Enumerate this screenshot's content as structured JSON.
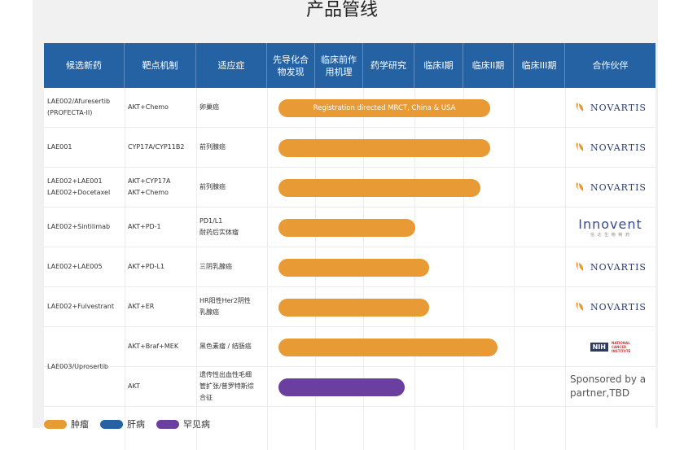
{
  "title": "产品管线",
  "header": [
    "候选新药",
    "靶点机制",
    "适应症",
    "先导化合物发现",
    "临床前作用机理",
    "药学研究",
    "临床I期",
    "临床II期",
    "临床III期",
    "合作伙伴"
  ],
  "rows": [
    {
      "drug": "LAE002/Afuresertib (PROFECTA-II)",
      "target": "AKT+Chemo",
      "indication": "卵巢癌",
      "bar_label": "Registration directed MRCT, China & USA",
      "progress": 0.62,
      "color": "orange",
      "partner": "novartis"
    },
    {
      "drug": "LAE001",
      "target": "CYP17A/CYP11B2",
      "indication": "前列腺癌",
      "bar_label": "",
      "progress": 0.62,
      "color": "orange",
      "partner": "novartis"
    },
    {
      "drug": "LAE002+LAE001\nLAE002+Docetaxel",
      "target": "AKT+CYP17A\nAKT+Chemo",
      "indication": "前列腺癌",
      "bar_label": "",
      "progress": 0.59,
      "color": "orange",
      "partner": "novartis"
    },
    {
      "drug": "LAE002+Sintilimab",
      "target": "AKT+PD-1",
      "indication": "PD1/L1\n耐药后实体瘤",
      "bar_label": "",
      "progress": 0.4,
      "color": "orange",
      "partner": "innovent"
    },
    {
      "drug": "LAE002+LAE005",
      "target": "AKT+PD-L1",
      "indication": "三阴乳腺癌",
      "bar_label": "",
      "progress": 0.44,
      "color": "orange",
      "partner": "novartis"
    },
    {
      "drug": "LAE002+Fulvestrant",
      "target": "AKT+ER",
      "indication": "HR阳性Her2阴性\n乳腺癌",
      "bar_label": "",
      "progress": 0.44,
      "color": "orange",
      "partner": "novartis"
    },
    {
      "drug": "",
      "target": "AKT+Braf+MEK",
      "indication": "黑色素瘤 / 结肠癌",
      "bar_label": "",
      "progress": 0.64,
      "color": "orange",
      "partner": "nih"
    },
    {
      "drug": "",
      "target": "AKT",
      "indication": "遗传性出血性毛细\n管扩张/普罗特斯综\n合征",
      "bar_label": "",
      "progress": 0.37,
      "color": "purple",
      "partner": "sponsor"
    }
  ],
  "merged_drug": "LAE003/Uprosertib",
  "partners": {
    "novartis": "NOVARTIS",
    "innovent_name": "Innovent",
    "innovent_sub": "信 达 生 物 制 药",
    "nih_box": "NIH",
    "nih_txt": "NATIONAL\nCANCER\nINSTITUTE",
    "sponsor": "Sponsored by a partner,TBD"
  },
  "legend": [
    {
      "label": "肿瘤",
      "color": "#e89a35"
    },
    {
      "label": "肝病",
      "color": "#2462a4"
    },
    {
      "label": "罕见病",
      "color": "#6b3fa0"
    }
  ],
  "colors": {
    "orange": "#e89a35",
    "purple": "#6b3fa0",
    "header": "#2462a4"
  }
}
